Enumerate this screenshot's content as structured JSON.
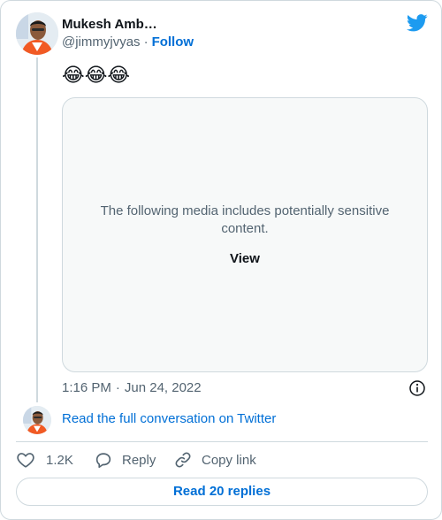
{
  "tweet": {
    "author_name": "Mukesh Amb…",
    "author_handle": "@jimmyjvyas",
    "separator": "·",
    "follow_label": "Follow",
    "text": "😂😂😂",
    "media_warning": "The following media includes potentially sensitive content.",
    "view_label": "View",
    "time": "1:16 PM",
    "date": "Jun 24, 2022"
  },
  "conversation": {
    "read_full_label": "Read the full conversation on Twitter"
  },
  "actions": {
    "likes": "1.2K",
    "reply_label": "Reply",
    "copy_label": "Copy link"
  },
  "footer": {
    "replies_button": "Read 20 replies"
  },
  "icons": {
    "brand": "twitter-bird-icon",
    "info": "info-icon",
    "like": "heart-icon",
    "reply": "reply-bubble-icon",
    "copy": "link-icon"
  },
  "colors": {
    "accent": "#006fd6",
    "twitter_blue": "#1d9bf0",
    "secondary_text": "#536471",
    "border": "#cfd9de"
  }
}
